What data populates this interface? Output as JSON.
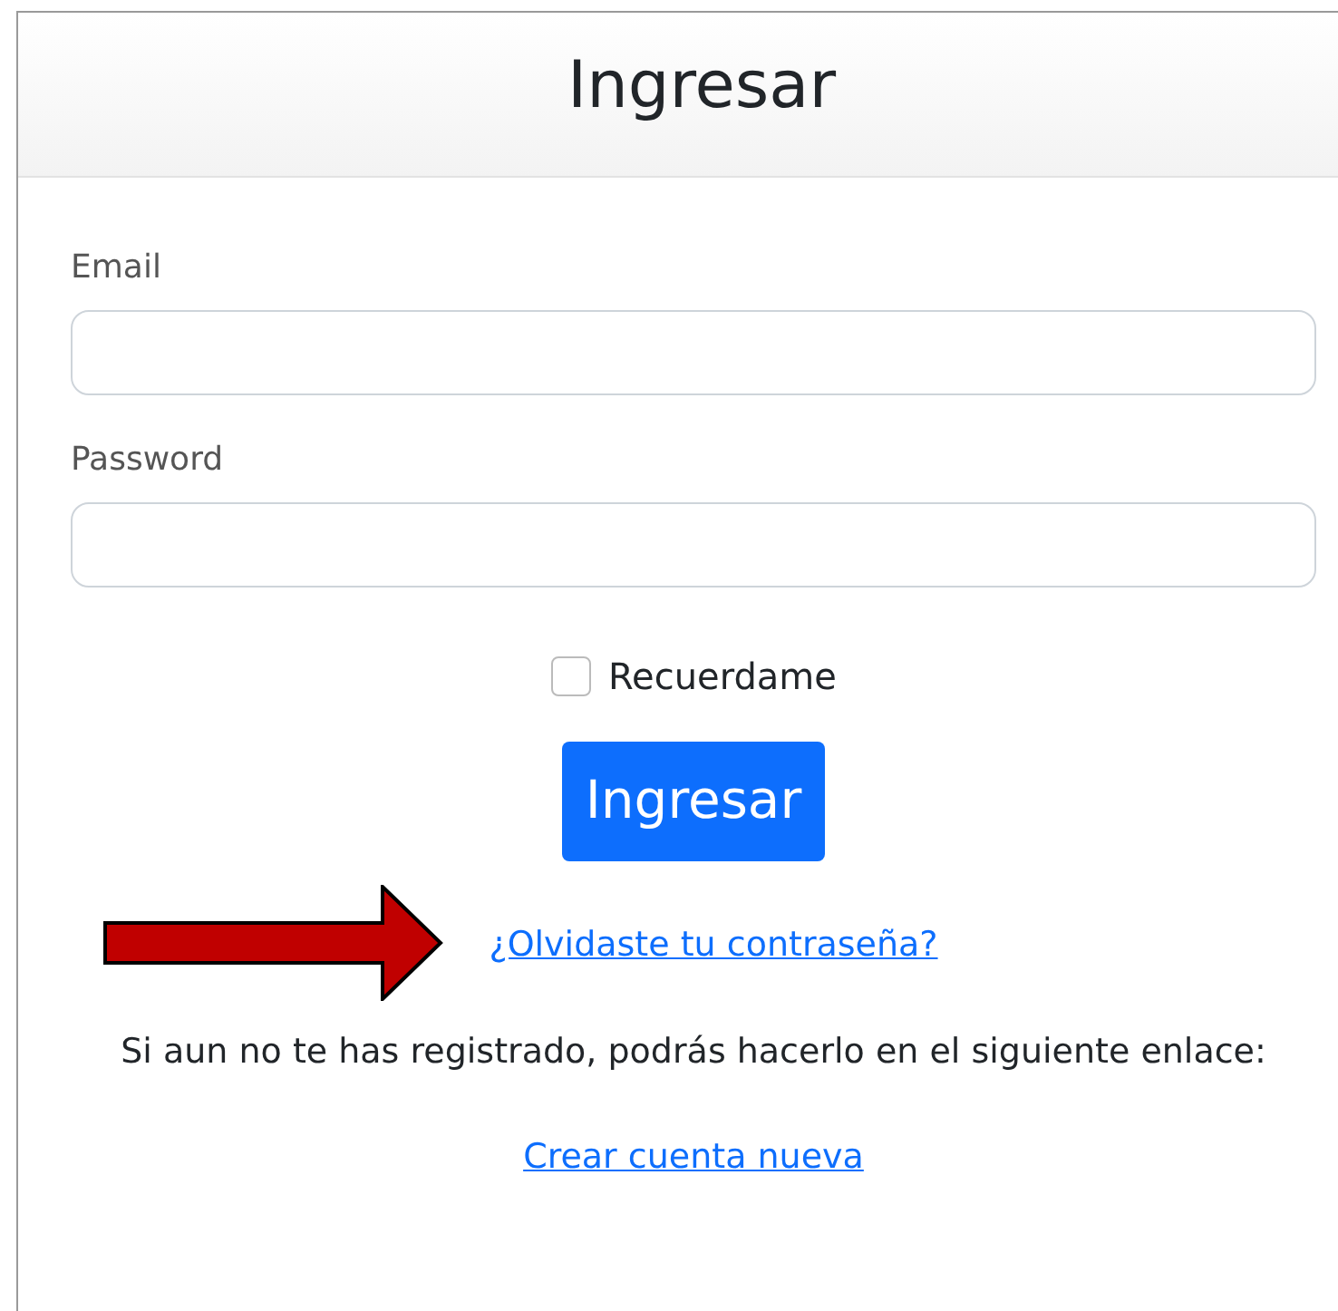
{
  "header": {
    "title": "Ingresar"
  },
  "form": {
    "fields": [
      {
        "label": "Email"
      },
      {
        "label": "Password"
      }
    ],
    "remember": {
      "label": "Recuerdame",
      "checked": false
    },
    "submit": "Ingresar",
    "forgot_link": "¿Olvidaste tu contraseña?",
    "register_text": "Si aun no te has registrado, podrás hacerlo en el siguiente enlace:",
    "register_link": "Crear cuenta nueva"
  }
}
